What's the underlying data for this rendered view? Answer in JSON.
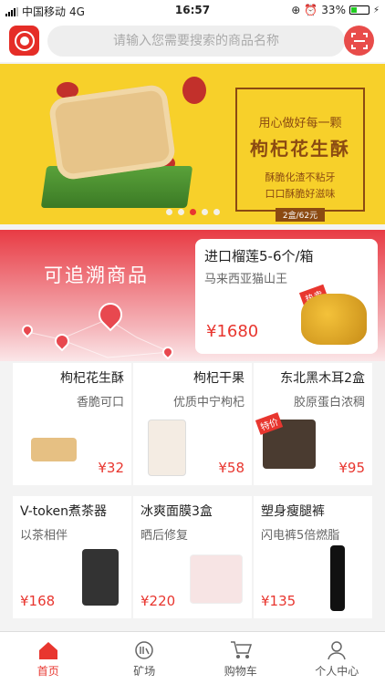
{
  "status": {
    "carrier": "中国移动",
    "network": "4G",
    "time": "16:57",
    "battery": "33%",
    "battery_level": 0.33
  },
  "search": {
    "placeholder": "请输入您需要搜索的商品名称"
  },
  "banner": {
    "line1": "用心做好每一颗",
    "line2": "枸杞花生酥",
    "line3": "酥脆化渣不粘牙",
    "line4": "口口酥脆好滋味",
    "badge": "2盒/62元",
    "slide_count": 5,
    "active_slide": 3
  },
  "trace": {
    "title": "可追溯商品"
  },
  "featured": {
    "title": "进口榴莲5-6个/箱",
    "subtitle": "马来西亚猫山王",
    "tag": "热卖",
    "price": "¥1680"
  },
  "row1": [
    {
      "title": "枸杞花生酥",
      "subtitle": "香脆可口",
      "price": "¥32"
    },
    {
      "title": "枸杞干果",
      "subtitle": "优质中宁枸杞",
      "price": "¥58"
    },
    {
      "title": "东北黑木耳2盒",
      "subtitle": "胶原蛋白浓稠",
      "price": "¥95",
      "tag": "特价"
    }
  ],
  "row2": [
    {
      "title": "V-token煮茶器",
      "subtitle": "以茶相伴",
      "price": "¥168"
    },
    {
      "title": "冰爽面膜3盒",
      "subtitle": "晒后修复",
      "price": "¥220"
    },
    {
      "title": "塑身瘦腿裤",
      "subtitle": "闪电裤5倍燃脂",
      "price": "¥135"
    }
  ],
  "tabs": [
    {
      "label": "首页",
      "icon": "home-icon",
      "active": true
    },
    {
      "label": "矿场",
      "icon": "mine-icon",
      "active": false
    },
    {
      "label": "购物车",
      "icon": "cart-icon",
      "active": false
    },
    {
      "label": "个人中心",
      "icon": "user-icon",
      "active": false
    }
  ],
  "colors": {
    "accent": "#e8362f",
    "banner_bg": "#f7d02a"
  }
}
